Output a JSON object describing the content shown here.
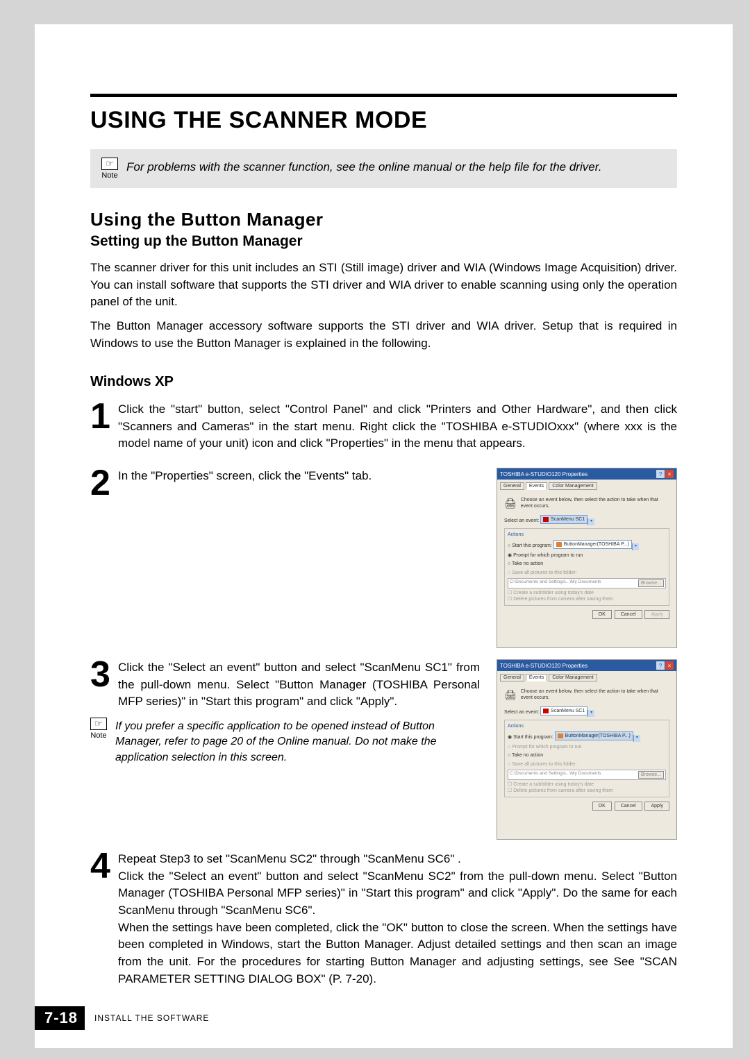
{
  "title": "USING THE SCANNER MODE",
  "note1": {
    "label": "Note",
    "text": "For problems with the scanner function, see the online manual or the help file for the driver."
  },
  "h2": "Using the Button Manager",
  "h3": "Setting up the Button Manager",
  "intro_p1": "The scanner driver for this unit includes an STI (Still image) driver and WIA (Windows Image Acquisition) driver. You can install software that supports the STI driver and WIA driver to enable scanning using only the operation panel of the unit.",
  "intro_p2": "The Button Manager accessory software supports the STI driver and WIA driver. Setup that is required in Windows to use the Button Manager is explained in the following.",
  "h4": "Windows XP",
  "steps": {
    "s1": {
      "num": "1",
      "text": "Click the \"start\" button, select \"Control Panel\" and click \"Printers and Other Hardware\", and then click \"Scanners and Cameras\" in the start menu. Right click the \"TOSHIBA e-STUDIOxxx\" (where xxx is the model name of your unit) icon and click \"Properties\" in the menu that appears."
    },
    "s2": {
      "num": "2",
      "text": "In the \"Properties\" screen, click the \"Events\" tab."
    },
    "s3": {
      "num": "3",
      "text": "Click the \"Select an event\" button and select \"ScanMenu SC1\" from the pull-down menu. Select \"Button Manager (TOSHIBA Personal MFP series)\" in \"Start this program\" and click \"Apply\"."
    },
    "s4": {
      "num": "4",
      "text_a": "Repeat Step3 to set \"ScanMenu SC2\" through \"ScanMenu SC6\" .",
      "text_b": "Click the \"Select an event\" button and select \"ScanMenu SC2\" from the pull-down menu. Select \"Button Manager (TOSHIBA Personal MFP series)\" in \"Start this program\" and click \"Apply\". Do the same for each ScanMenu through \"ScanMenu SC6\".",
      "text_c": "When the settings have been completed, click the \"OK\" button to close the screen. When the settings have been completed in Windows, start the Button Manager. Adjust detailed settings and then scan an image from the unit. For the procedures for starting Button Manager and adjusting settings, see See \"SCAN PARAMETER SETTING DIALOG BOX\" (P. 7-20)."
    }
  },
  "note2": {
    "label": "Note",
    "text": "If you prefer a specific application to be opened instead of Button Manager, refer to page 20 of the Online manual. Do not make the application selection in this screen."
  },
  "figure": {
    "title": "TOSHIBA e-STUDIO120 Properties",
    "tabs": {
      "general": "General",
      "events": "Events",
      "color": "Color Management"
    },
    "desc": "Choose an event below, then select the action to take when that event occurs.",
    "select_label": "Select an event:",
    "select_value1": "ScanMenu SC1",
    "select_value2": "ScanMenu SC1",
    "actions_label": "Actions",
    "start_program": "Start this program:",
    "program_value": "ButtonManager(TOSHIBA P...)",
    "prompt": "Prompt for which program to run",
    "take_no_action": "Take no action",
    "save_all": "Save all pictures to this folder:",
    "path": "C:\\Documents and Settings\\...\\My Documents",
    "browse": "Browse...",
    "subfolder": "Create a subfolder using today's date",
    "delete_after": "Delete pictures from camera after saving them",
    "ok": "OK",
    "cancel": "Cancel",
    "apply": "Apply"
  },
  "footer": {
    "page": "7-18",
    "section": "INSTALL THE SOFTWARE"
  }
}
